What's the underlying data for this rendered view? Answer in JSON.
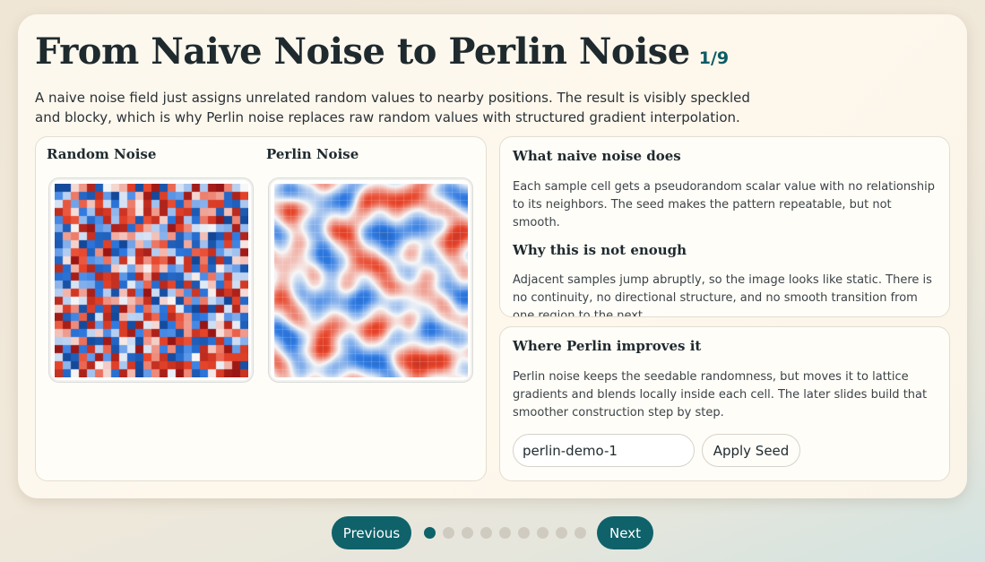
{
  "slide": {
    "title": "From Naive Noise to Perlin Noise",
    "counter": "1/9",
    "lead": "A naive noise field just assigns unrelated random values to nearby positions. The result is visibly speckled and blocky, which is why Perlin noise replaces raw random values with structured gradient interpolation."
  },
  "visuals": {
    "random_label": "Random Noise",
    "perlin_label": "Perlin Noise"
  },
  "info": {
    "section1_title": "What naive noise does",
    "section1_text": "Each sample cell gets a pseudorandom scalar value with no relationship to its neighbors. The seed makes the pattern repeatable, but not smooth.",
    "section2_title": "Why this is not enough",
    "section2_text": "Adjacent samples jump abruptly, so the image looks like static. There is no continuity, no directional structure, and no smooth transition from one region to the next.",
    "section3_title": "Where Perlin improves it",
    "section3_text": "Perlin noise keeps the seedable randomness, but moves it to lattice gradients and blends locally inside each cell. The later slides build that smoother construction step by step."
  },
  "seed": {
    "value": "perlin-demo-1",
    "apply_label": "Apply Seed"
  },
  "nav": {
    "previous_label": "Previous",
    "next_label": "Next",
    "total_slides": 9,
    "current_slide": 1
  },
  "colors": {
    "accent": "#0f626a",
    "cold": "#2f7be3",
    "warm": "#e8452a",
    "neutral": "#f7f7f7"
  }
}
